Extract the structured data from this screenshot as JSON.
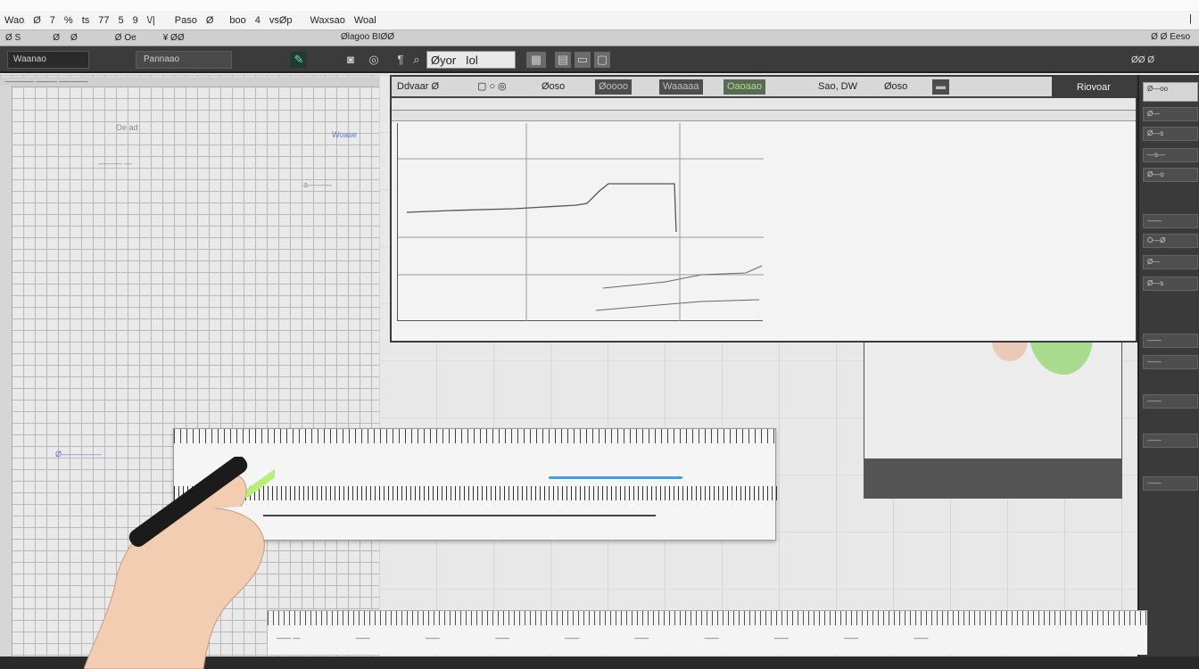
{
  "app": {
    "menu": [
      "Wao",
      "Ø",
      "7",
      "%",
      "ts",
      "77",
      "5",
      "9",
      "\\/|",
      "Paso",
      "Ø",
      "boo",
      "4",
      "vsØp",
      "Waxsao",
      "Woal"
    ],
    "menu_right": "|",
    "toolbar1": [
      "Ø S",
      "Ø",
      "Ø",
      "Ø Oe",
      "¥ ØØ"
    ],
    "toolbar1_center": "Ølagoo",
    "toolbar1_center2": "BIØØ",
    "toolbar1_right": "Ø Ø  Eeso",
    "toolbar2": {
      "field_label": "Waanao",
      "block_label": "Pannaao",
      "search_value": "Øyor",
      "search_value2": "Iol",
      "right_icons": "ØØ Ø"
    }
  },
  "left_panel": {
    "tab_text": "———— ——— ————",
    "ghost_labels": [
      "Oe ad",
      "——— —",
      "Woase",
      "a———",
      "Ø—————"
    ]
  },
  "editor": {
    "toolbar": {
      "title": "Ddvaar Ø",
      "btn1": "Øoso",
      "btn2": "Øoooo",
      "btn3": "Waaaaa",
      "btn_green": "Oaoaao",
      "btn4": "Sao, DW",
      "btn5": "Øoso"
    },
    "right_header": "Riovoar"
  },
  "right_panel": {
    "items": [
      "Ø—oo",
      "Ø—",
      "Ø—s",
      "—s—",
      "Ø—o",
      "——",
      "O—Ø",
      "Ø—",
      "Ø—s",
      "——",
      "——",
      "——",
      "——",
      "——"
    ]
  },
  "bottom_scale": {
    "labels": [
      "—— —",
      "——",
      "——",
      "——",
      "——",
      "——",
      "——",
      "——",
      "——",
      "——"
    ]
  },
  "colors": {
    "accent_green": "#9cd87c",
    "accent_blue": "#3aa3f0",
    "panel_dark": "#3a3a3a"
  },
  "icons": [
    "search-icon",
    "pen-icon",
    "save-icon",
    "settings-icon",
    "hand-icon"
  ]
}
